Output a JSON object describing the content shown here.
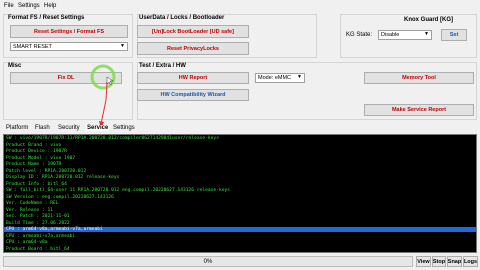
{
  "menu": [
    "File",
    "Settings",
    "Help"
  ],
  "format_group": {
    "title": "Format FS / Reset Settings",
    "reset_btn": "Reset Settings / Format FS",
    "select_value": "SMART RESET"
  },
  "userdata_group": {
    "title": "UserData / Locks / Bootloader",
    "unlock_btn": "[Un]Lock BootLoader [UD safe]",
    "reset_locks_btn": "Reset PrivacyLocks"
  },
  "knox_group": {
    "title": "Knox Guard [KG]",
    "kg_label": "KG State:",
    "kg_value": "Disable",
    "set_btn": "Set"
  },
  "misc_group": {
    "title": "Misc",
    "fix_dl_btn": "Fix DL"
  },
  "test_group": {
    "title": "Test / Extra / HW",
    "hw_report_btn": "HW Report",
    "hw_wizard_btn": "HW Compatibility Wizard",
    "mode_value": "Mode: eMMC",
    "memory_tool_btn": "Memory Tool",
    "service_report_btn": "Make Service Report"
  },
  "tabs": [
    "Platform",
    "Flash",
    "Security",
    "Service",
    "Settings"
  ],
  "active_tab": "Service",
  "console_lines": [
    "SW : vivo/1907R/1907R:11/RP1A.200720.012/compiler06271429041user/release-keys",
    "Product Brand : vivo",
    "Product Device : 1907R",
    "Product Model : vivo 1907",
    "Product Name : 1907R",
    "Patch level : RP1A.200720.012",
    "Display ID : RP1A.200720.012 release-keys",
    "Product Info : bitl_64",
    "SW : full_bitl_64-user 11 RP1A.200720.012 eng.compil.20220627.143126 release-keys",
    "SW Version : eng.compil.20220627.143126",
    "Ver. CodeName : REL",
    "Ver. Release : 11",
    "Sec. Patch : 2021-11-01",
    "Build Time : 27.06.2022",
    "CPU : arm64-v8a,armeabi-v7a,armeabi",
    "CPU : armeabi-v7a,armeabi",
    "CPU : arm64-v8a",
    "Product Board : bitl_64"
  ],
  "highlight_line_index": 14,
  "status": {
    "progress_text": "0%",
    "progress_value": 0,
    "buttons": [
      "View",
      "Stop",
      "Snap",
      "Logs"
    ]
  }
}
